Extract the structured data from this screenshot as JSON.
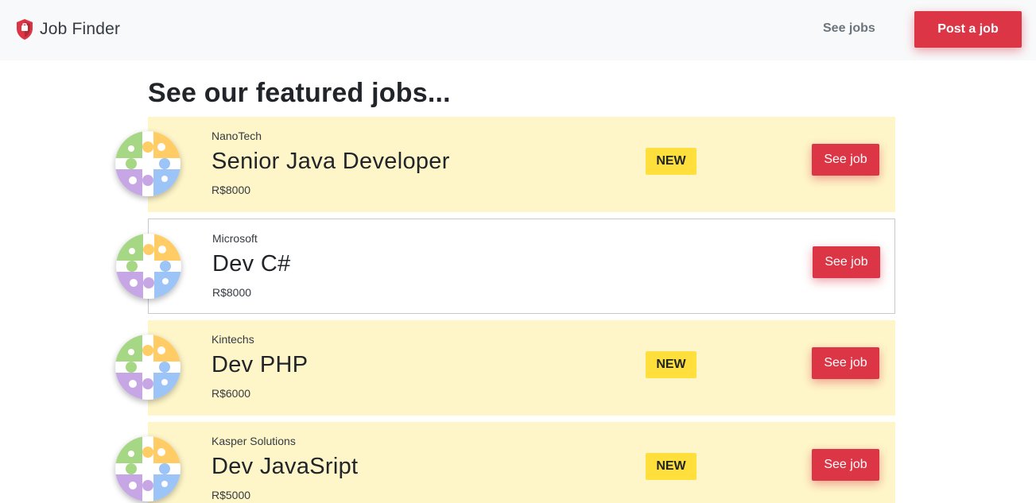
{
  "navbar": {
    "brand_icon": "shield-icon",
    "brand_name": "Job Finder",
    "see_jobs_label": "See jobs",
    "post_job_label": "Post a job"
  },
  "main": {
    "title": "See our featured jobs..."
  },
  "jobs": [
    {
      "company": "NanoTech",
      "title": "Senior Java Developer",
      "salary": "R$8000",
      "featured": true,
      "badge": "NEW",
      "button_label": "See job",
      "logo_icon": "puzzle-icon"
    },
    {
      "company": "Microsoft",
      "title": "Dev C#",
      "salary": "R$8000",
      "featured": false,
      "badge": "",
      "button_label": "See job",
      "logo_icon": "puzzle-icon"
    },
    {
      "company": "Kintechs",
      "title": "Dev PHP",
      "salary": "R$6000",
      "featured": true,
      "badge": "NEW",
      "button_label": "See job",
      "logo_icon": "puzzle-icon"
    },
    {
      "company": "Kasper Solutions",
      "title": "Dev JavaSript",
      "salary": "R$5000",
      "featured": true,
      "badge": "NEW",
      "button_label": "See job",
      "logo_icon": "puzzle-icon"
    }
  ],
  "colors": {
    "accent_red": "#dc3545",
    "featured_background": "#fef6c9",
    "badge_yellow": "#ffdf3b",
    "navbar_background": "#f8f9fa"
  }
}
